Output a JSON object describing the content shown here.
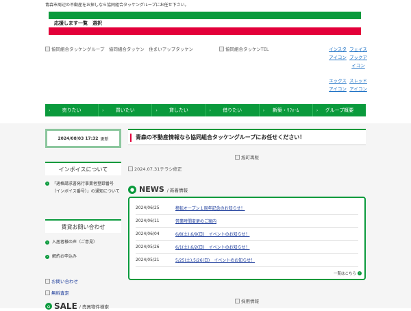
{
  "tagline": "青森市周辺の不動産をお探しなら協同組合タッケングループにお任せ下さい。",
  "banner": {
    "label": "応援します一覧　選択"
  },
  "header": {
    "logo_alt": "協同組合タッケングループ　協同組合タッケン　住まいアップタッケン",
    "tel_alt": "協同組合タッケンTEL",
    "social": [
      [
        "インスタアイコン",
        "フェイスブックアイコン"
      ],
      [
        "エックスアイコン",
        "スレッドアイコン"
      ]
    ]
  },
  "nav": {
    "items": [
      "売りたい",
      "買いたい",
      "貸したい",
      "借りたい",
      "新築・ﾘﾌｫｰﾑ",
      "グループ概要"
    ]
  },
  "updated": {
    "date": "2024/08/03 17:32",
    "suffix": "更新"
  },
  "sidebar": {
    "invoice_heading": "インボイスについて",
    "invoice_item": "「適格請求書発行事業者登録番号（インボイス番号）」の通知について",
    "rental_heading": "賃貸お問い合わせ",
    "rental_items": [
      "入居者様の声（ご意見）",
      "解約お申込み"
    ],
    "contact_alt": "お問い合わせ",
    "estimate_alt": "無料査定",
    "sale_title": "SALE",
    "sale_sub": "/ 売買物件検索"
  },
  "main": {
    "heading": "青森の不動産情報なら協同組合タッケングループにお任せください！",
    "img1_alt": "旭町再販",
    "img2_alt": "2024.07.31チラシ修正",
    "news_title": "NEWS",
    "news_sub": "/ 新着情報",
    "news": [
      {
        "date": "2024/06/25",
        "text": "移転オープン１周年記念のお知らせ！"
      },
      {
        "date": "2024/06/11",
        "text": "営業時間変更のご案内"
      },
      {
        "date": "2024/06/04",
        "text": "6/8(土),6/9(日)　イベントのお知らせ！"
      },
      {
        "date": "2024/05/26",
        "text": "6/1(土),6/2(日)　イベントのお知らせ！"
      },
      {
        "date": "2024/05/21",
        "text": "5/25(土),5/26(日)　イベントのお知らせ！"
      }
    ],
    "more": "一覧はこちら",
    "recruit_alt": "採用情報"
  },
  "colors": {
    "green": "#0a9a3c",
    "red": "#e3003a"
  }
}
